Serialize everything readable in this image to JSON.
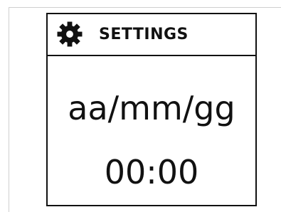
{
  "header": {
    "title": "SETTINGS",
    "icon": "gear-icon"
  },
  "display": {
    "date_format": "aa/mm/gg",
    "time": "00:00"
  },
  "colors": {
    "ink": "#111111",
    "background": "#ffffff"
  }
}
